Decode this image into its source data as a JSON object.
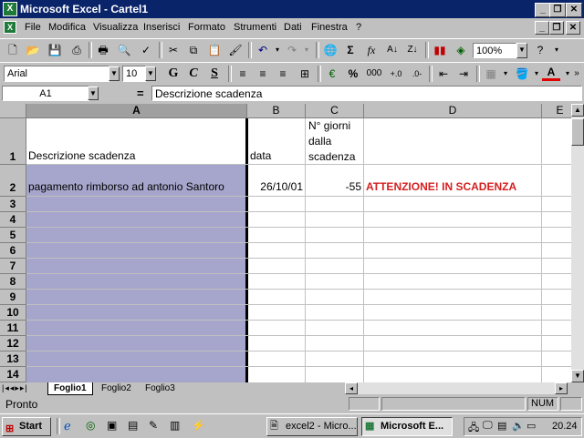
{
  "window": {
    "title": "Microsoft Excel - Cartel1"
  },
  "menu": [
    "File",
    "Modifica",
    "Visualizza",
    "Inserisci",
    "Formato",
    "Strumenti",
    "Dati",
    "Finestra",
    "?"
  ],
  "toolbar": {
    "zoom": "100%"
  },
  "format": {
    "font": "Arial",
    "size": "10",
    "bold": "G",
    "italic": "C",
    "underline": "S",
    "thousands": "000",
    "percent": "%"
  },
  "formula": {
    "namebox": "A1",
    "equals": "=",
    "content": "Descrizione scadenza"
  },
  "grid": {
    "columns": [
      "A",
      "B",
      "C",
      "D",
      "E"
    ],
    "rows": [
      "1",
      "2",
      "3",
      "4",
      "5",
      "6",
      "7",
      "8",
      "9",
      "10",
      "11",
      "12",
      "13",
      "14"
    ],
    "row1": {
      "a": "Descrizione scadenza",
      "b": "data",
      "c": [
        "N° giorni",
        "dalla",
        "scadenza"
      ]
    },
    "row2": {
      "a": "pagamento rimborso ad antonio Santoro",
      "b": "26/10/01",
      "c": "-55",
      "d": "ATTENZIONE! IN SCADENZA"
    }
  },
  "sheets": [
    "Foglio1",
    "Foglio2",
    "Foglio3"
  ],
  "status": {
    "text": "Pronto",
    "num": "NUM"
  },
  "taskbar": {
    "start": "Start",
    "tasks": [
      "excel2 - Micro...",
      "Microsoft E..."
    ],
    "clock": "20.24"
  },
  "colors": {
    "titlebar": "#0a246a",
    "selection": "#a6a6cc",
    "alert": "#d42020"
  }
}
